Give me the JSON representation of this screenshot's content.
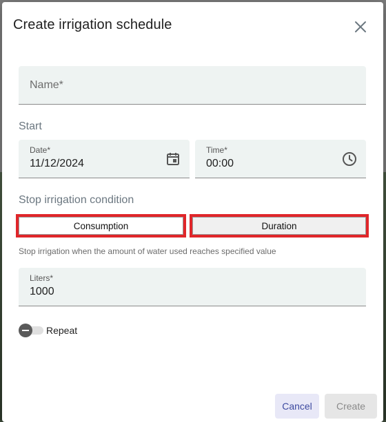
{
  "dialog": {
    "title": "Create irrigation schedule",
    "close_icon": "close-icon"
  },
  "name_field": {
    "placeholder": "Name*",
    "value": ""
  },
  "start": {
    "section_label": "Start",
    "date": {
      "label": "Date*",
      "value": "11/12/2024",
      "icon": "calendar-icon"
    },
    "time": {
      "label": "Time*",
      "value": "00:00",
      "icon": "clock-icon"
    }
  },
  "stop_condition": {
    "section_label": "Stop irrigation condition",
    "options": [
      {
        "label": "Consumption",
        "selected": true
      },
      {
        "label": "Duration",
        "selected": false
      }
    ],
    "hint": "Stop irrigation when the amount of water used reaches specified value",
    "liters": {
      "label": "Liters*",
      "value": "1000"
    }
  },
  "repeat": {
    "label": "Repeat",
    "enabled": false
  },
  "actions": {
    "cancel_label": "Cancel",
    "create_label": "Create",
    "create_enabled": false
  },
  "colors": {
    "accent": "#3d4aa0",
    "highlight_border": "#e0262a",
    "field_bg": "#eef3f2",
    "selected_option_bg": "#ffffff",
    "unselected_option_bg": "#f0f0f0"
  }
}
